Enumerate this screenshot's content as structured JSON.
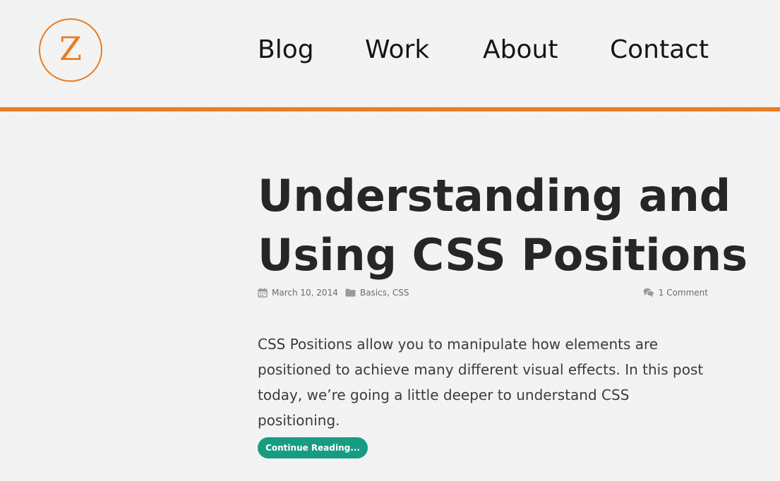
{
  "header": {
    "logo_letter": "Z",
    "nav": [
      {
        "label": "Blog"
      },
      {
        "label": "Work"
      },
      {
        "label": "About"
      },
      {
        "label": "Contact"
      }
    ]
  },
  "post": {
    "title_line1": "Understanding and",
    "title_line2": "Using CSS Positions",
    "date": "March 10, 2014",
    "categories": [
      "Basics",
      "CSS"
    ],
    "category_separator": ",",
    "comments": "1 Comment",
    "excerpt": "CSS Positions allow you to manipulate how elements are positioned to achieve many different visual effects. In this post today, we’re going a little deeper to understand CSS positioning.",
    "read_more": "Continue Reading..."
  },
  "colors": {
    "accent": "#e87e22",
    "button": "#179c82",
    "background": "#f4f4f4",
    "title": "#262626"
  },
  "icons": [
    "calendar-icon",
    "folder-icon",
    "comments-icon"
  ]
}
